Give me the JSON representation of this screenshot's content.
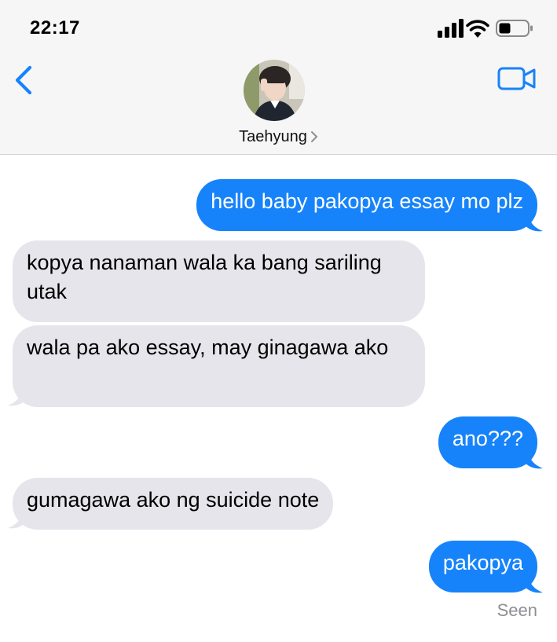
{
  "status_bar": {
    "time": "22:17",
    "icons": [
      "signal-icon",
      "wifi-icon",
      "battery-icon"
    ]
  },
  "header": {
    "contact_name": "Taehyung",
    "icons": [
      "back-chevron-icon",
      "video-camera-icon",
      "avatar",
      "chevron-right-icon"
    ]
  },
  "messages": [
    {
      "direction": "outgoing",
      "text": "hello baby pakopya essay mo plz"
    },
    {
      "direction": "incoming",
      "text": "kopya nanaman wala ka bang sariling utak"
    },
    {
      "direction": "incoming",
      "text": "wala pa ako essay, may ginagawa ako"
    },
    {
      "direction": "outgoing",
      "text": "ano???"
    },
    {
      "direction": "incoming",
      "text": "gumagawa ako ng suicide note"
    },
    {
      "direction": "outgoing",
      "text": "pakopya"
    }
  ],
  "receipt": "Seen",
  "colors": {
    "accent": "#1783fa",
    "incoming_bubble": "#e6e5eb",
    "header_bg": "#f6f6f6",
    "secondary_text": "#8e8e93"
  }
}
